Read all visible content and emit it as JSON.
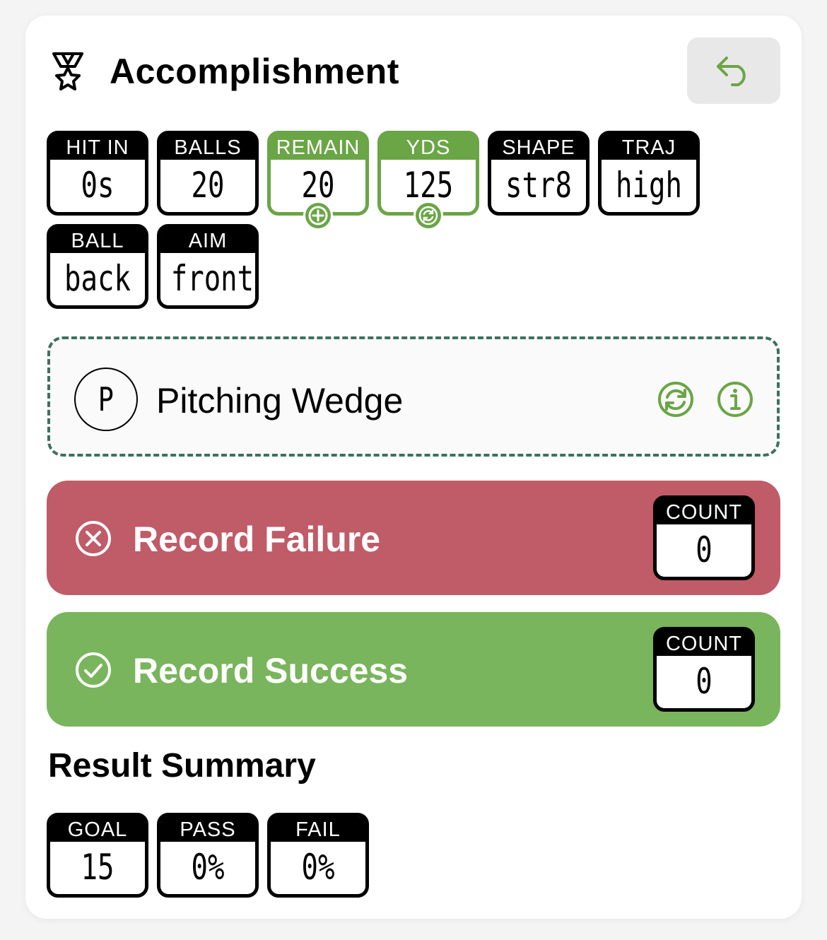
{
  "header": {
    "title": "Accomplishment",
    "icon": "medal-star-icon",
    "back_icon": "undo-arrow-icon"
  },
  "stats": [
    {
      "label": "HIT IN",
      "value": "0s"
    },
    {
      "label": "BALLS",
      "value": "20"
    },
    {
      "label": "REMAIN",
      "value": "20",
      "badge_icon": "plus-circle-icon"
    },
    {
      "label": "YDS",
      "value": "125",
      "badge_icon": "refresh-icon"
    },
    {
      "label": "SHAPE",
      "value": "str8"
    },
    {
      "label": "TRAJ",
      "value": "high"
    },
    {
      "label": "BALL",
      "value": "back"
    },
    {
      "label": "AIM",
      "value": "front"
    }
  ],
  "club": {
    "letter": "P",
    "name": "Pitching Wedge",
    "swap_icon": "refresh-icon",
    "info_icon": "info-icon"
  },
  "records": {
    "failure": {
      "label": "Record Failure",
      "count_label": "COUNT",
      "count": "0",
      "icon": "x-circle-icon"
    },
    "success": {
      "label": "Record Success",
      "count_label": "COUNT",
      "count": "0",
      "icon": "check-circle-icon"
    }
  },
  "summary": {
    "title": "Result Summary",
    "items": [
      {
        "label": "GOAL",
        "value": "15"
      },
      {
        "label": "PASS",
        "value": "0%"
      },
      {
        "label": "FAIL",
        "value": "0%"
      }
    ]
  },
  "colors": {
    "accent_green": "#6aa546",
    "failure_red": "#c05b68",
    "success_green": "#79b55c",
    "dashed_border": "#3e7060"
  }
}
